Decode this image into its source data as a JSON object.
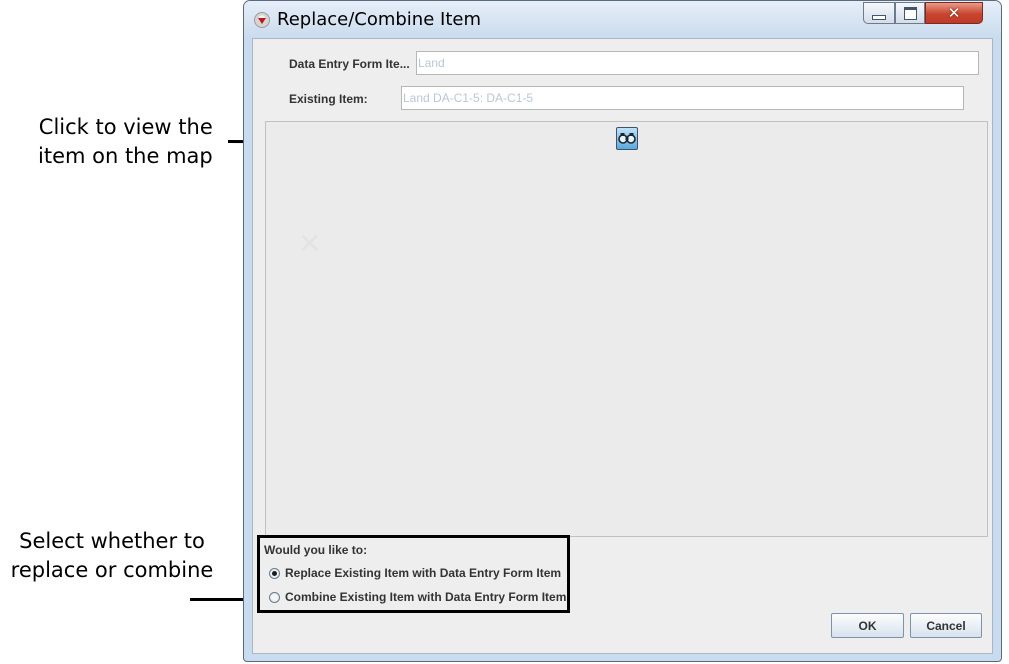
{
  "annotations": {
    "view_map": [
      "Click to view the",
      "item on the map"
    ],
    "choose": [
      "Select whether to",
      "replace or combine"
    ]
  },
  "window": {
    "title": "Replace/Combine Item",
    "close_glyph": "✕"
  },
  "form": {
    "data_entry_label": "Data Entry Form Ite...",
    "data_entry_value": "Land",
    "existing_label": "Existing Item:",
    "existing_value": "Land DA-C1-5: DA-C1-5"
  },
  "map_panel": {
    "view_button_icon": "binoculars-icon",
    "faint_mark": "✕"
  },
  "choice": {
    "prompt": "Would you like to:",
    "options": [
      {
        "label": "Replace Existing Item with Data Entry Form Item",
        "selected": true
      },
      {
        "label": "Combine Existing Item with Data Entry Form Item",
        "selected": false
      }
    ]
  },
  "buttons": {
    "ok": "OK",
    "cancel": "Cancel"
  },
  "colors": {
    "window_frame": "#c9dcef",
    "close_button": "#c9452e",
    "placeholder_text": "#b9c7d6"
  }
}
